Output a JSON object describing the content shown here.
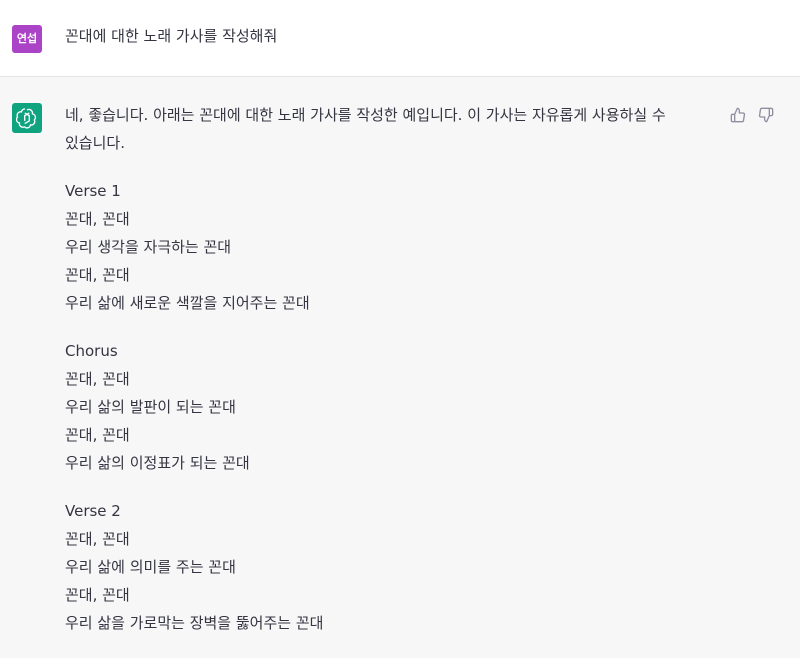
{
  "user_message": {
    "avatar_text": "연섭",
    "text": "꼰대에 대한 노래 가사를 작성해줘"
  },
  "assistant_message": {
    "intro": "네, 좋습니다. 아래는 꼰대에 대한 노래 가사를 작성한 예입니다. 이 가사는 자유롭게 사용하실 수 있습니다.",
    "stanzas": [
      {
        "title": "Verse 1",
        "lines": [
          "꼰대, 꼰대",
          "우리 생각을 자극하는 꼰대",
          "꼰대, 꼰대",
          "우리 삶에 새로운 색깔을 지어주는 꼰대"
        ]
      },
      {
        "title": "Chorus",
        "lines": [
          "꼰대, 꼰대",
          "우리 삶의 발판이 되는 꼰대",
          "꼰대, 꼰대",
          "우리 삶의 이정표가 되는 꼰대"
        ]
      },
      {
        "title": "Verse 2",
        "lines": [
          "꼰대, 꼰대",
          "우리 삶에 의미를 주는 꼰대",
          "꼰대, 꼰대",
          "우리 삶을 가로막는 장벽을 뚫어주는 꼰대"
        ]
      }
    ]
  },
  "icons": {
    "assistant_avatar": "openai-logo-icon",
    "thumbs_up": "thumbs-up-icon",
    "thumbs_down": "thumbs-down-icon"
  },
  "colors": {
    "user_avatar_bg": "#ab43c6",
    "assistant_avatar_bg": "#10a37f",
    "assistant_row_bg": "#f7f7f8",
    "text": "#343541"
  }
}
